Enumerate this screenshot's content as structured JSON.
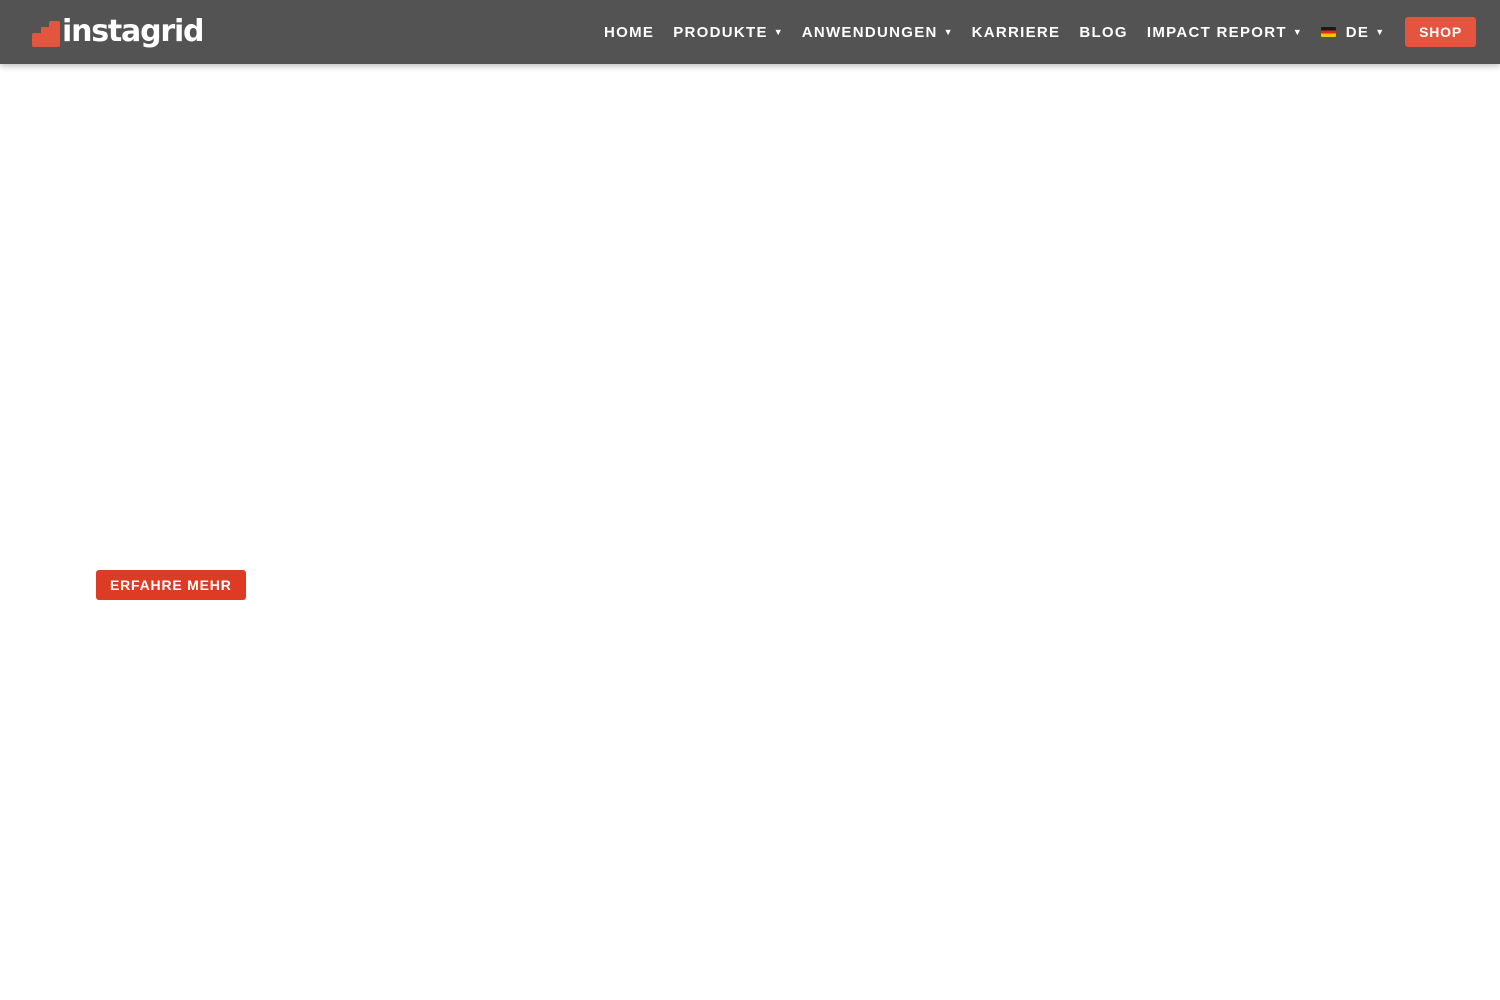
{
  "brand": {
    "name": "instagrid",
    "accent_color": "#e5543e",
    "header_color": "#535353"
  },
  "nav": {
    "items": [
      {
        "label": "HOME",
        "has_dropdown": false
      },
      {
        "label": "PRODUKTE",
        "has_dropdown": true
      },
      {
        "label": "ANWENDUNGEN",
        "has_dropdown": true
      },
      {
        "label": "KARRIERE",
        "has_dropdown": false
      },
      {
        "label": "BLOG",
        "has_dropdown": false
      },
      {
        "label": "IMPACT REPORT",
        "has_dropdown": true
      }
    ],
    "language": {
      "label": "DE",
      "icon": "germany-flag-icon"
    },
    "caret_glyph": "▼",
    "shop_label": "SHOP"
  },
  "hero": {
    "cta_label": "ERFAHRE MEHR",
    "cta_color": "#dd3b23"
  }
}
